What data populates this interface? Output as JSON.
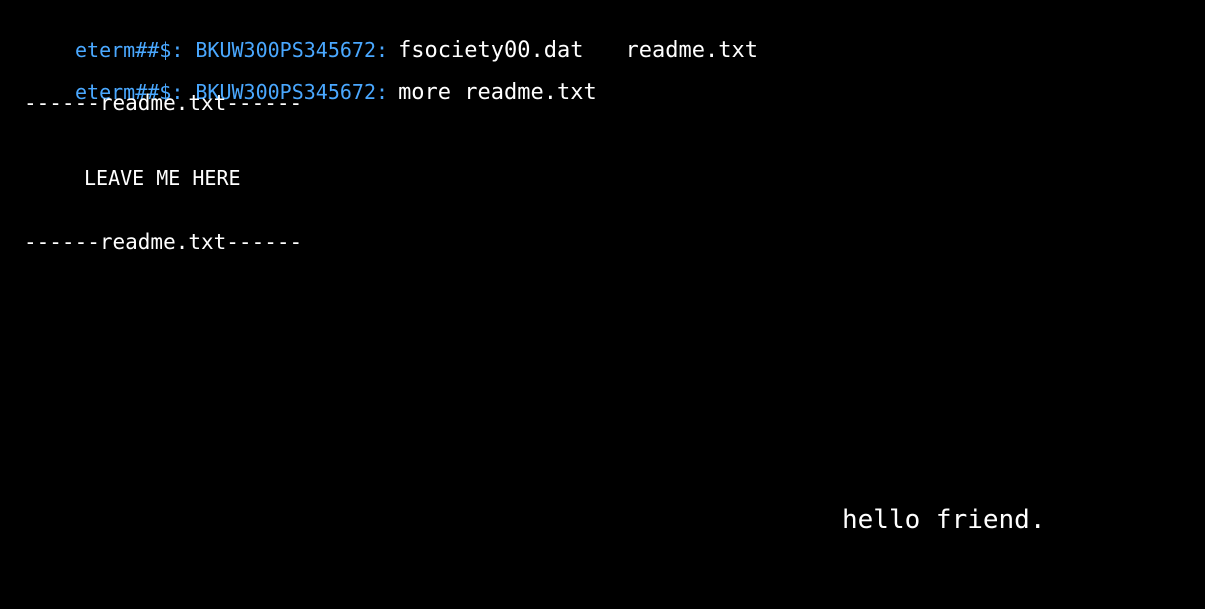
{
  "terminal": {
    "prompt": "eterm##$: BKUW300PS345672:",
    "history": [
      {
        "files": [
          "fsociety00.dat",
          "readme.txt"
        ]
      },
      {
        "command": "more readme.txt"
      }
    ],
    "file_header": "------readme.txt------",
    "file_content": "LEAVE ME HERE",
    "file_footer": "------readme.txt------",
    "message": "hello friend."
  },
  "colors": {
    "background": "#000000",
    "prompt": "#4aa8ff",
    "text": "#ffffff"
  }
}
